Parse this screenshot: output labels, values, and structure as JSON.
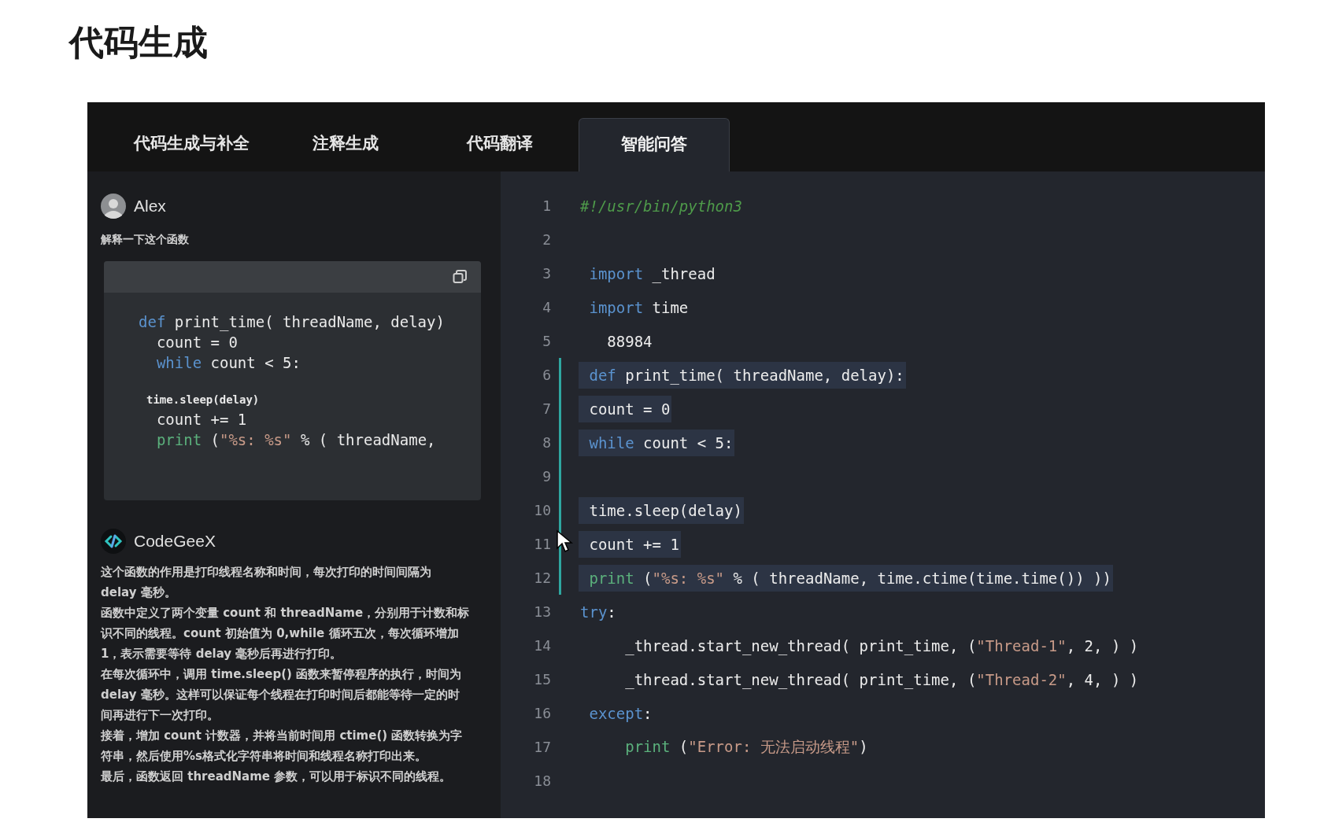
{
  "page_title": "代码生成",
  "tabs": [
    {
      "label": "代码生成与补全",
      "selected": false
    },
    {
      "label": "注释生成",
      "selected": false
    },
    {
      "label": "代码翻译",
      "selected": false
    },
    {
      "label": "智能问答",
      "selected": true
    }
  ],
  "chat": {
    "user": {
      "name": "Alex",
      "prompt": "解释一下这个函数"
    },
    "snippet": [
      {
        "kind": "code",
        "tokens": [
          {
            "text": "def",
            "kind": "keyword"
          },
          {
            "text": " print_time( threadName, delay)",
            "kind": "plain"
          }
        ]
      },
      {
        "kind": "code",
        "tokens": [
          {
            "text": "  count = 0",
            "kind": "plain"
          }
        ]
      },
      {
        "kind": "code",
        "tokens": [
          {
            "text": "  while",
            "kind": "keyword"
          },
          {
            "text": " count < 5:",
            "kind": "plain"
          }
        ]
      },
      {
        "kind": "blank"
      },
      {
        "kind": "small",
        "tokens": [
          {
            "text": "time.sleep(delay)",
            "kind": "plain"
          }
        ]
      },
      {
        "kind": "code",
        "tokens": [
          {
            "text": "  count += 1",
            "kind": "plain"
          }
        ]
      },
      {
        "kind": "code",
        "tokens": [
          {
            "text": "  print",
            "kind": "builtin"
          },
          {
            "text": " (",
            "kind": "plain"
          },
          {
            "text": "\"%s: %s\"",
            "kind": "string"
          },
          {
            "text": " % ( threadName,",
            "kind": "plain"
          }
        ]
      }
    ],
    "assistant": {
      "name": "CodeGeeX",
      "paragraphs": [
        "这个函数的作用是打印线程名称和时间，每次打印的时间间隔为 delay 毫秒。",
        "函数中定义了两个变量 count 和 threadName，分别用于计数和标识不同的线程。count 初始值为 0,while 循环五次，每次循环增加 1，表示需要等待 delay 毫秒后再进行打印。",
        "在每次循环中，调用 time.sleep() 函数来暂停程序的执行，时间为 delay 毫秒。这样可以保证每个线程在打印时间后都能等待一定的时间再进行下一次打印。",
        "接着，增加 count 计数器，并将当前时间用 ctime() 函数转换为字符串，然后使用%s格式化字符串将时间和线程名称打印出来。",
        "最后，函数返回 threadName 参数，可以用于标识不同的线程。"
      ]
    }
  },
  "editor": {
    "lines": [
      {
        "number": "1",
        "highlighted": false,
        "tokens": [
          {
            "text": "#!/usr/bin/python3",
            "kind": "comment"
          }
        ]
      },
      {
        "number": "2",
        "highlighted": false
      },
      {
        "number": "3",
        "highlighted": false,
        "tokens": [
          {
            "text": " import",
            "kind": "keyword"
          },
          {
            "text": " _thread",
            "kind": "plain"
          }
        ]
      },
      {
        "number": "4",
        "highlighted": false,
        "tokens": [
          {
            "text": " import",
            "kind": "keyword"
          },
          {
            "text": " time",
            "kind": "plain"
          }
        ]
      },
      {
        "number": "5",
        "highlighted": false,
        "tokens": [
          {
            "text": "   88984",
            "kind": "plain"
          }
        ]
      },
      {
        "number": "6",
        "highlighted": true,
        "tokens": [
          {
            "text": " def",
            "kind": "keyword"
          },
          {
            "text": " print_time( threadName, delay):",
            "kind": "plain"
          }
        ]
      },
      {
        "number": "7",
        "highlighted": true,
        "tokens": [
          {
            "text": " count = 0",
            "kind": "plain"
          }
        ]
      },
      {
        "number": "8",
        "highlighted": true,
        "tokens": [
          {
            "text": " while",
            "kind": "keyword"
          },
          {
            "text": " count < 5:",
            "kind": "plain"
          }
        ]
      },
      {
        "number": "9",
        "highlighted": true
      },
      {
        "number": "10",
        "highlighted": true,
        "tokens": [
          {
            "text": " time.sleep(delay)",
            "kind": "plain"
          }
        ]
      },
      {
        "number": "11",
        "highlighted": true,
        "tokens": [
          {
            "text": " count += 1",
            "kind": "plain"
          }
        ]
      },
      {
        "number": "12",
        "highlighted": true,
        "tokens": [
          {
            "text": " print",
            "kind": "builtin"
          },
          {
            "text": " (",
            "kind": "plain"
          },
          {
            "text": "\"%s: %s\"",
            "kind": "string"
          },
          {
            "text": " % ( threadName, time.ctime(time.time()) ))",
            "kind": "plain"
          }
        ]
      },
      {
        "number": "13",
        "highlighted": false,
        "tokens": [
          {
            "text": "try",
            "kind": "keyword"
          },
          {
            "text": ":",
            "kind": "plain"
          }
        ]
      },
      {
        "number": "14",
        "highlighted": false,
        "tokens": [
          {
            "text": "     _thread.start_new_thread( print_time, (",
            "kind": "plain"
          },
          {
            "text": "\"Thread-1\"",
            "kind": "string"
          },
          {
            "text": ", 2, ) )",
            "kind": "plain"
          }
        ]
      },
      {
        "number": "15",
        "highlighted": false,
        "tokens": [
          {
            "text": "     _thread.start_new_thread( print_time, (",
            "kind": "plain"
          },
          {
            "text": "\"Thread-2\"",
            "kind": "string"
          },
          {
            "text": ", 4, ) )",
            "kind": "plain"
          }
        ]
      },
      {
        "number": "16",
        "highlighted": false,
        "tokens": [
          {
            "text": " except",
            "kind": "keyword"
          },
          {
            "text": ":",
            "kind": "plain"
          }
        ]
      },
      {
        "number": "17",
        "highlighted": false,
        "tokens": [
          {
            "text": "     print",
            "kind": "builtin"
          },
          {
            "text": " (",
            "kind": "plain"
          },
          {
            "text": "\"Error: 无法启动线程\"",
            "kind": "string"
          },
          {
            "text": ")",
            "kind": "plain"
          }
        ]
      },
      {
        "number": "18",
        "highlighted": false
      }
    ]
  }
}
